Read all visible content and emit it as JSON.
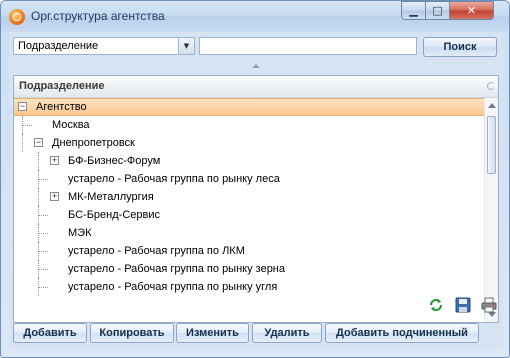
{
  "window": {
    "title": "Орг.структура агентства",
    "minimize_glyph": "▁",
    "maximize_glyph": "□",
    "close_glyph": "✕"
  },
  "search": {
    "field_selected": "Подразделение",
    "field_arrow": "▼",
    "query_value": "",
    "query_placeholder": "",
    "button_label": "Поиск"
  },
  "tree": {
    "column_header": "Подразделение",
    "rows": [
      {
        "label": "Агентство",
        "level": 0,
        "toggle": "−",
        "selected": true
      },
      {
        "label": "Москва",
        "level": 1,
        "toggle": "",
        "selected": false
      },
      {
        "label": "Днепропетровск",
        "level": 1,
        "toggle": "−",
        "selected": false
      },
      {
        "label": "БФ-Бизнес-Форум",
        "level": 2,
        "toggle": "+",
        "selected": false
      },
      {
        "label": "устарело - Рабочая группа по рынку леса",
        "level": 2,
        "toggle": "",
        "selected": false
      },
      {
        "label": "МК-Металлургия",
        "level": 2,
        "toggle": "+",
        "selected": false
      },
      {
        "label": "БС-Бренд-Сервис",
        "level": 2,
        "toggle": "",
        "selected": false
      },
      {
        "label": "МЭК",
        "level": 2,
        "toggle": "",
        "selected": false
      },
      {
        "label": "устарело - Рабочая группа по ЛКМ",
        "level": 2,
        "toggle": "",
        "selected": false
      },
      {
        "label": "устарело - Рабочая группа по рынку зерна",
        "level": 2,
        "toggle": "",
        "selected": false
      },
      {
        "label": "устарело - Рабочая группа по рынку угля",
        "level": 2,
        "toggle": "",
        "selected": false
      }
    ]
  },
  "tools": {
    "refresh_icon": "refresh-icon",
    "save_icon": "save-icon",
    "print_icon": "print-icon"
  },
  "actions": {
    "add": "Добавить",
    "copy": "Копировать",
    "edit": "Изменить",
    "delete": "Удалить",
    "add_child": "Добавить подчиненный"
  },
  "colors": {
    "selection": "#f9c88f",
    "window_frame": "#bcd2ec",
    "close_button": "#c0402e"
  }
}
